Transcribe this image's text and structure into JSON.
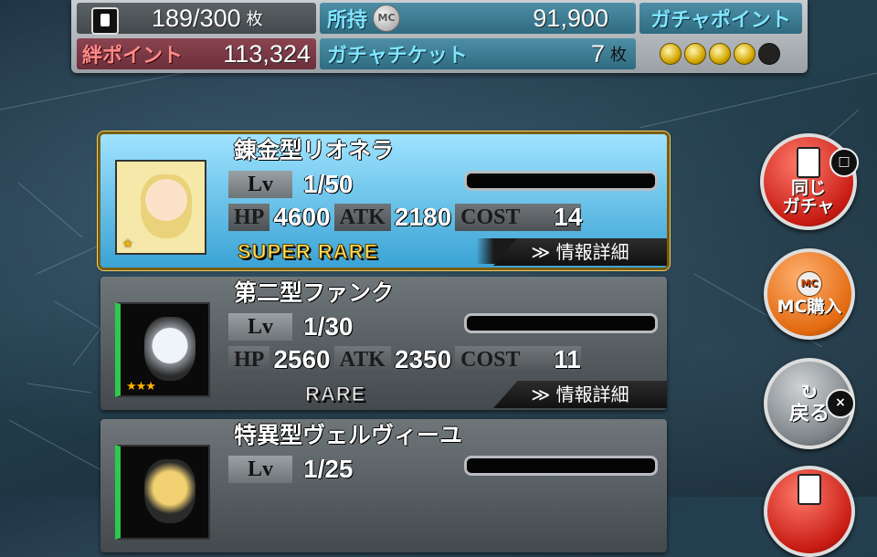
{
  "status": {
    "card_count": "189",
    "card_max": "/300",
    "card_unit": "枚",
    "owned_label": "所持",
    "mc_icon": "MC",
    "mc_value": "91,900",
    "gacha_point_label": "ガチャポイント",
    "gacha_point_filled": 4,
    "gacha_point_total": 5,
    "kizuna_label": "絆ポイント",
    "kizuna_value": "113,324",
    "ticket_label": "ガチャチケット",
    "ticket_value": "7",
    "ticket_unit": "枚"
  },
  "units": [
    {
      "name": "錬金型リオネラ",
      "lv_label": "Lv",
      "lv": "1/50",
      "hp_label": "HP",
      "hp": "4600",
      "atk_label": "ATK",
      "atk": "2180",
      "cost_label": "COST",
      "cost": "14",
      "rarity": "SUPER RARE",
      "detail": "≫ 情報詳細",
      "stars": "★"
    },
    {
      "name": "第二型ファンク",
      "lv_label": "Lv",
      "lv": "1/30",
      "hp_label": "HP",
      "hp": "2560",
      "atk_label": "ATK",
      "atk": "2350",
      "cost_label": "COST",
      "cost": "11",
      "rarity": "RARE",
      "detail": "≫ 情報詳細",
      "stars": "★★★"
    },
    {
      "name": "特異型ヴェルヴィーユ",
      "lv_label": "Lv",
      "lv": "1/25"
    }
  ],
  "side": {
    "same_gacha": "同じ\nガチャ",
    "same_badge": "□",
    "mc_buy_icon": "MC",
    "mc_buy": "MC購入",
    "back": "戻る",
    "back_badge": "×",
    "back_arrow": "↻"
  }
}
